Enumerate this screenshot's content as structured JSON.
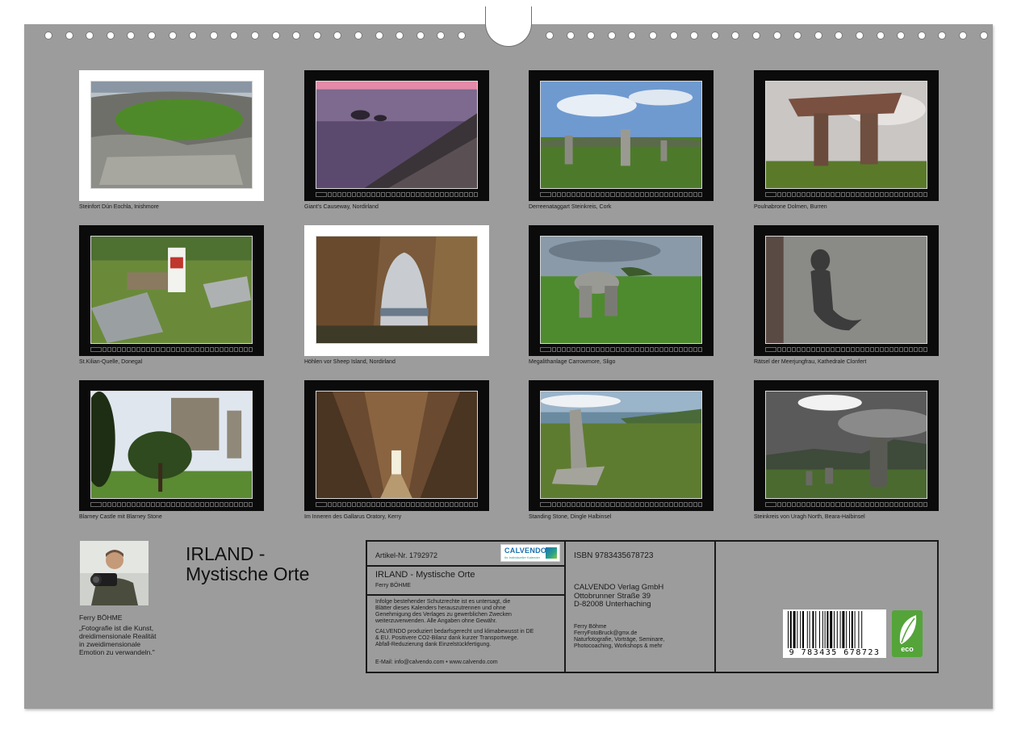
{
  "colors": {
    "page_background": "#9c9c9c",
    "frame_black": "#0b0b0b",
    "frame_white": "#ffffff",
    "eco_green": "#54a43a",
    "calvendo_blue": "#1b6fb0"
  },
  "photos": [
    {
      "caption": "Steinfort Dún Eochla, Inishmore",
      "frame": "white",
      "scene": "stone-fort-icon"
    },
    {
      "caption": "Giant's Causeway, Nordirland",
      "frame": "black",
      "scene": "causeway-icon"
    },
    {
      "caption": "Derreenataggart Steinkreis, Cork",
      "frame": "black",
      "scene": "stone-circle-icon"
    },
    {
      "caption": "Poulnabrone Dolmen, Burren",
      "frame": "black",
      "scene": "dolmen-icon"
    },
    {
      "caption": "St.Kilian-Quelle, Donegal",
      "frame": "black",
      "scene": "holy-well-icon"
    },
    {
      "caption": "Höhlen vor Sheep Island, Nordirland",
      "frame": "white",
      "scene": "sea-cave-icon"
    },
    {
      "caption": "Megalithanlage Carrowmore, Sligo",
      "frame": "black",
      "scene": "megalith-icon"
    },
    {
      "caption": "Rätsel der Meerjungfrau, Kathedrale Clonfert",
      "frame": "black",
      "scene": "mermaid-carving-icon"
    },
    {
      "caption": "Blarney Castle mit Blarney Stone",
      "frame": "black",
      "scene": "castle-icon"
    },
    {
      "caption": "Im Inneren des Gallarus Oratory, Kerry",
      "frame": "black",
      "scene": "oratory-interior-icon"
    },
    {
      "caption": "Standing Stone, Dingle Halbinsel",
      "frame": "black",
      "scene": "standing-stone-icon"
    },
    {
      "caption": "Steinkreis von Uragh North, Beara-Halbinsel",
      "frame": "black",
      "scene": "stone-circle-mountains-icon"
    }
  ],
  "author": {
    "name": "Ferry BÖHME",
    "quote": "„Fotografie ist die Kunst,\ndreidimensionale Realität\nin zweidimensionale\nEmotion zu verwandeln.\""
  },
  "title": "IRLAND -\nMystische Orte",
  "info": {
    "article_no": "Artikel-Nr. 1792972",
    "logo_word": "CALVENDO",
    "logo_sub": "Ihr individueller Kalender",
    "product_title": "IRLAND - Mystische Orte",
    "product_author": "Ferry BÖHME",
    "legal": "Infolge bestehender Schutzrechte ist es untersagt, die\nBlätter dieses Kalenders herauszutrennen und ohne\nGenehmigung des Verlages zu gewerblichen Zwecken\nweiterzuverwenden. Alle Angaben ohne Gewähr.",
    "eco_note": "CALVENDO produziert bedarfsgerecht und klimabewusst in DE\n& EU. Positivere CO2-Bilanz dank kurzer Transportwege.\nAbfall-Reduzierung dank Einzelstückfertigung.",
    "contact": "E-Mail: info@calvendo.com • www.calvendo.com",
    "isbn": "ISBN 9783435678723",
    "publisher": "CALVENDO Verlag GmbH\nOttobrunner Straße 39\nD-82008 Unterhaching",
    "author_contact": "Ferry Böhme\nFerryFotoBruck@gmx.de\nNaturfotografie, Vorträge, Seminare,\nPhotocoaching, Workshops & mehr",
    "barcode_digits": "9 783435 678723",
    "eco_label": "eco"
  }
}
